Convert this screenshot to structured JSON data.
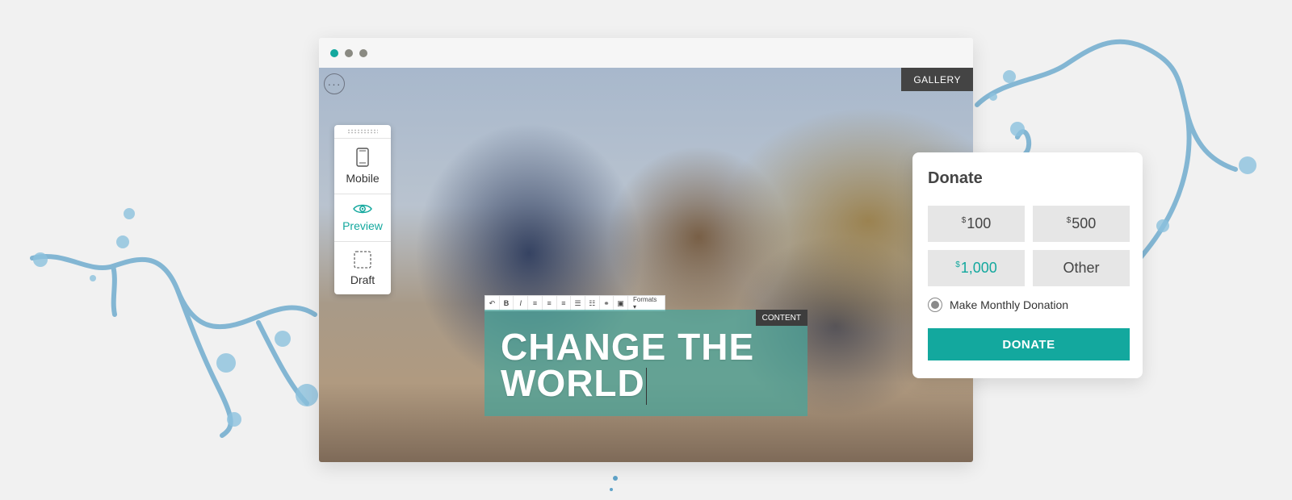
{
  "colors": {
    "accent": "#13a89e",
    "tag_bg": "#444444",
    "overlay": "#46a59b"
  },
  "window": {
    "controls": [
      "teal-dot",
      "gray-dot",
      "gray-dot"
    ],
    "menu_icon": "more-dots-icon",
    "gallery_label": "GALLERY"
  },
  "device_panel": {
    "items": [
      {
        "label": "Mobile",
        "icon": "mobile-phone-icon",
        "active": false
      },
      {
        "label": "Preview",
        "icon": "eye-icon",
        "active": true
      },
      {
        "label": "Draft",
        "icon": "dashed-frame-icon",
        "active": false
      }
    ]
  },
  "editor": {
    "toolbar": {
      "buttons": [
        "undo-icon",
        "bold",
        "italic",
        "align-left-icon",
        "align-center-icon",
        "align-right-icon",
        "bullet-list-icon",
        "numbered-list-icon",
        "link-icon",
        "image-icon"
      ],
      "bold_label": "B",
      "italic_label": "I",
      "formats_label": "Formats ▾"
    },
    "content_tag": "CONTENT",
    "headline_line1": "CHANGE THE",
    "headline_line2": "WORLD"
  },
  "donate": {
    "title": "Donate",
    "currency": "$",
    "amounts": [
      {
        "value": "100",
        "selected": false
      },
      {
        "value": "500",
        "selected": false
      },
      {
        "value": "1,000",
        "selected": true
      }
    ],
    "other_label": "Other",
    "monthly_label": "Make Monthly Donation",
    "button_label": "DONATE"
  }
}
